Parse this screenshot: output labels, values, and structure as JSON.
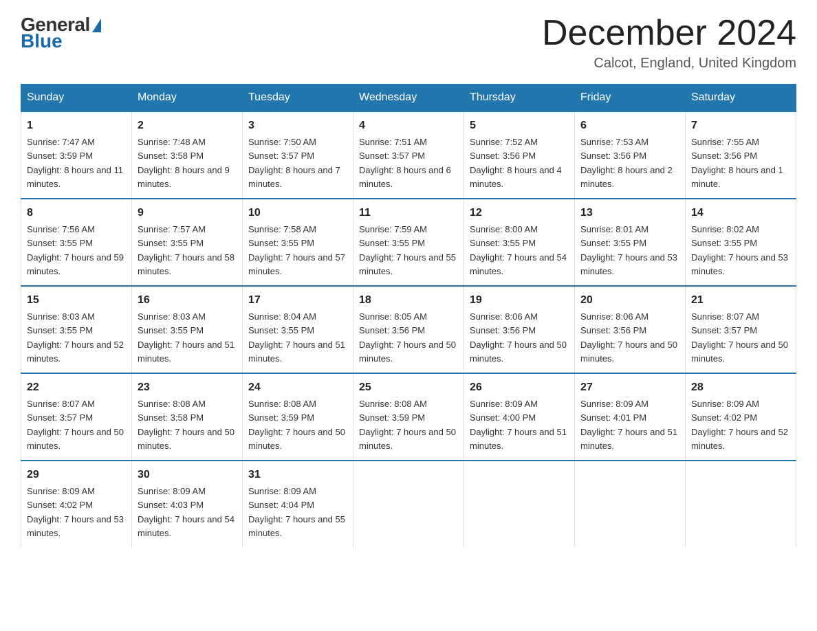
{
  "logo": {
    "general": "General",
    "blue": "Blue",
    "triangle": "▶"
  },
  "header": {
    "month_year": "December 2024",
    "location": "Calcot, England, United Kingdom"
  },
  "weekdays": [
    "Sunday",
    "Monday",
    "Tuesday",
    "Wednesday",
    "Thursday",
    "Friday",
    "Saturday"
  ],
  "weeks": [
    [
      {
        "day": "1",
        "sunrise": "7:47 AM",
        "sunset": "3:59 PM",
        "daylight": "8 hours and 11 minutes."
      },
      {
        "day": "2",
        "sunrise": "7:48 AM",
        "sunset": "3:58 PM",
        "daylight": "8 hours and 9 minutes."
      },
      {
        "day": "3",
        "sunrise": "7:50 AM",
        "sunset": "3:57 PM",
        "daylight": "8 hours and 7 minutes."
      },
      {
        "day": "4",
        "sunrise": "7:51 AM",
        "sunset": "3:57 PM",
        "daylight": "8 hours and 6 minutes."
      },
      {
        "day": "5",
        "sunrise": "7:52 AM",
        "sunset": "3:56 PM",
        "daylight": "8 hours and 4 minutes."
      },
      {
        "day": "6",
        "sunrise": "7:53 AM",
        "sunset": "3:56 PM",
        "daylight": "8 hours and 2 minutes."
      },
      {
        "day": "7",
        "sunrise": "7:55 AM",
        "sunset": "3:56 PM",
        "daylight": "8 hours and 1 minute."
      }
    ],
    [
      {
        "day": "8",
        "sunrise": "7:56 AM",
        "sunset": "3:55 PM",
        "daylight": "7 hours and 59 minutes."
      },
      {
        "day": "9",
        "sunrise": "7:57 AM",
        "sunset": "3:55 PM",
        "daylight": "7 hours and 58 minutes."
      },
      {
        "day": "10",
        "sunrise": "7:58 AM",
        "sunset": "3:55 PM",
        "daylight": "7 hours and 57 minutes."
      },
      {
        "day": "11",
        "sunrise": "7:59 AM",
        "sunset": "3:55 PM",
        "daylight": "7 hours and 55 minutes."
      },
      {
        "day": "12",
        "sunrise": "8:00 AM",
        "sunset": "3:55 PM",
        "daylight": "7 hours and 54 minutes."
      },
      {
        "day": "13",
        "sunrise": "8:01 AM",
        "sunset": "3:55 PM",
        "daylight": "7 hours and 53 minutes."
      },
      {
        "day": "14",
        "sunrise": "8:02 AM",
        "sunset": "3:55 PM",
        "daylight": "7 hours and 53 minutes."
      }
    ],
    [
      {
        "day": "15",
        "sunrise": "8:03 AM",
        "sunset": "3:55 PM",
        "daylight": "7 hours and 52 minutes."
      },
      {
        "day": "16",
        "sunrise": "8:03 AM",
        "sunset": "3:55 PM",
        "daylight": "7 hours and 51 minutes."
      },
      {
        "day": "17",
        "sunrise": "8:04 AM",
        "sunset": "3:55 PM",
        "daylight": "7 hours and 51 minutes."
      },
      {
        "day": "18",
        "sunrise": "8:05 AM",
        "sunset": "3:56 PM",
        "daylight": "7 hours and 50 minutes."
      },
      {
        "day": "19",
        "sunrise": "8:06 AM",
        "sunset": "3:56 PM",
        "daylight": "7 hours and 50 minutes."
      },
      {
        "day": "20",
        "sunrise": "8:06 AM",
        "sunset": "3:56 PM",
        "daylight": "7 hours and 50 minutes."
      },
      {
        "day": "21",
        "sunrise": "8:07 AM",
        "sunset": "3:57 PM",
        "daylight": "7 hours and 50 minutes."
      }
    ],
    [
      {
        "day": "22",
        "sunrise": "8:07 AM",
        "sunset": "3:57 PM",
        "daylight": "7 hours and 50 minutes."
      },
      {
        "day": "23",
        "sunrise": "8:08 AM",
        "sunset": "3:58 PM",
        "daylight": "7 hours and 50 minutes."
      },
      {
        "day": "24",
        "sunrise": "8:08 AM",
        "sunset": "3:59 PM",
        "daylight": "7 hours and 50 minutes."
      },
      {
        "day": "25",
        "sunrise": "8:08 AM",
        "sunset": "3:59 PM",
        "daylight": "7 hours and 50 minutes."
      },
      {
        "day": "26",
        "sunrise": "8:09 AM",
        "sunset": "4:00 PM",
        "daylight": "7 hours and 51 minutes."
      },
      {
        "day": "27",
        "sunrise": "8:09 AM",
        "sunset": "4:01 PM",
        "daylight": "7 hours and 51 minutes."
      },
      {
        "day": "28",
        "sunrise": "8:09 AM",
        "sunset": "4:02 PM",
        "daylight": "7 hours and 52 minutes."
      }
    ],
    [
      {
        "day": "29",
        "sunrise": "8:09 AM",
        "sunset": "4:02 PM",
        "daylight": "7 hours and 53 minutes."
      },
      {
        "day": "30",
        "sunrise": "8:09 AM",
        "sunset": "4:03 PM",
        "daylight": "7 hours and 54 minutes."
      },
      {
        "day": "31",
        "sunrise": "8:09 AM",
        "sunset": "4:04 PM",
        "daylight": "7 hours and 55 minutes."
      },
      null,
      null,
      null,
      null
    ]
  ],
  "labels": {
    "sunrise": "Sunrise:",
    "sunset": "Sunset:",
    "daylight": "Daylight:"
  }
}
